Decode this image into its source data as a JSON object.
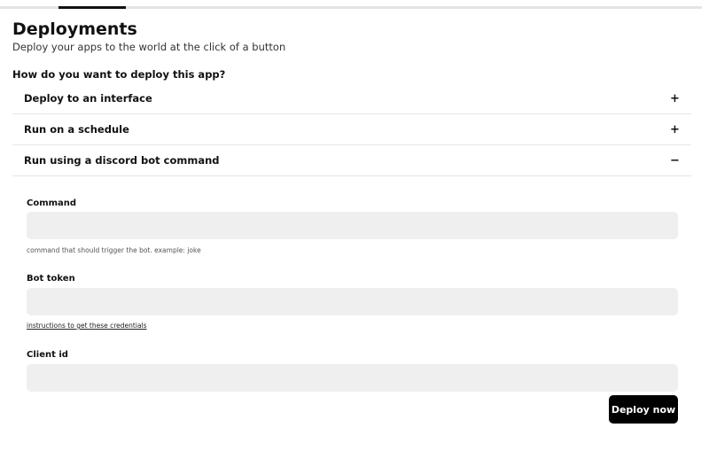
{
  "header": {
    "title": "Deployments",
    "subtitle": "Deploy your apps to the world at the click of a button",
    "question": "How do you want to deploy this app?"
  },
  "progress": {
    "step": 2,
    "of": 10
  },
  "accordion": {
    "items": [
      {
        "label": "Deploy to an interface",
        "toggle": "+",
        "expanded": false
      },
      {
        "label": "Run on a schedule",
        "toggle": "+",
        "expanded": false
      },
      {
        "label": "Run using a discord bot command",
        "toggle": "−",
        "expanded": true
      }
    ]
  },
  "form": {
    "command": {
      "label": "Command",
      "value": "",
      "hint": "command that should trigger the bot. example: joke"
    },
    "bot_token": {
      "label": "Bot token",
      "value": "",
      "link": "instructions to get these credentials"
    },
    "client_id": {
      "label": "Client id",
      "value": ""
    },
    "submit_label": "Deploy now"
  },
  "colors": {
    "accent": "#000000",
    "input_bg": "#efefef",
    "divider": "#e6e6e6",
    "progress_track": "#e4e4e4"
  }
}
